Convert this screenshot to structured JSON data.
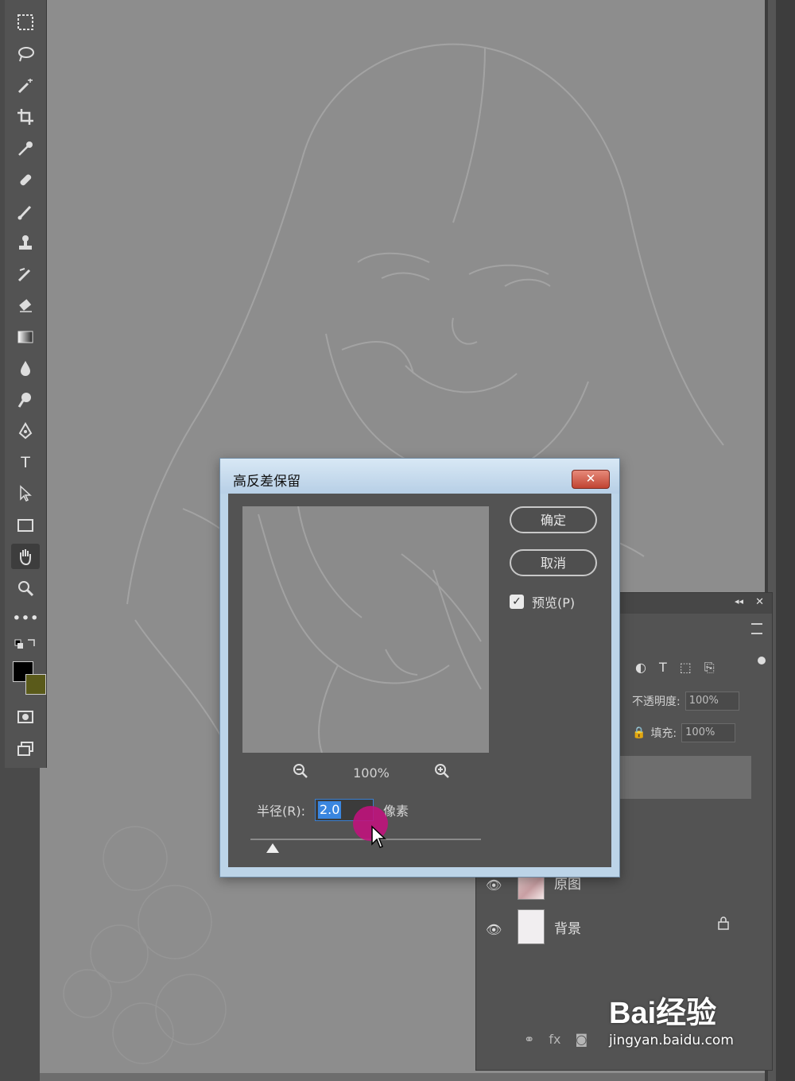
{
  "dialog": {
    "title": "高反差保留",
    "close_label": "✕",
    "ok_label": "确定",
    "cancel_label": "取消",
    "preview_label": "预览(P)",
    "preview_checked": true,
    "zoom_level": "100%",
    "radius_label": "半径(R):",
    "radius_value": "2.0",
    "radius_unit": "像素"
  },
  "layers_panel": {
    "opacity_label": "不透明度:",
    "opacity_value": "100%",
    "fill_label": "填充:",
    "fill_value": "100%",
    "layers": [
      {
        "name": "原图",
        "visible": true,
        "locked": false
      },
      {
        "name": "背景",
        "visible": true,
        "locked": true
      }
    ]
  },
  "toolbar": {
    "tools": [
      "marquee-icon",
      "lasso-icon",
      "magic-wand-icon",
      "crop-icon",
      "eyedropper-icon",
      "healing-brush-icon",
      "brush-icon",
      "clone-stamp-icon",
      "history-brush-icon",
      "eraser-icon",
      "gradient-icon",
      "blur-icon",
      "dodge-icon",
      "pen-icon",
      "type-icon",
      "path-selection-icon",
      "rectangle-icon",
      "hand-icon",
      "zoom-icon",
      "more-tools-icon"
    ],
    "active_tool": "hand-icon",
    "foreground_color": "#000000",
    "background_color": "#5a5a1a"
  },
  "watermark": {
    "brand": "Bai经验",
    "url": "jingyan.baidu.com"
  }
}
